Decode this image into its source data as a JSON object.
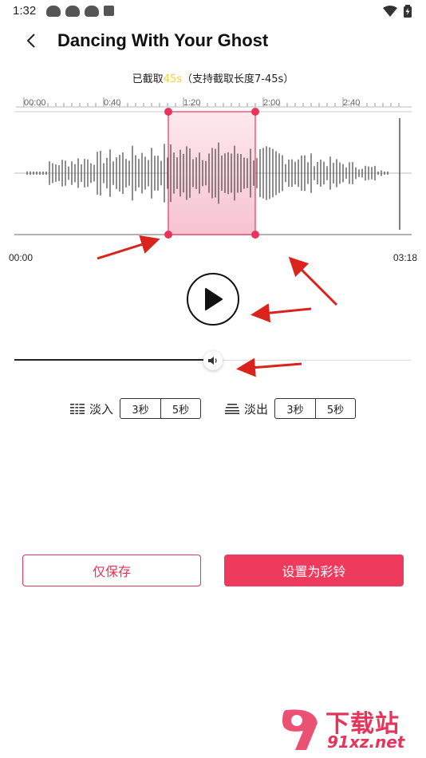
{
  "status_bar": {
    "time": "1:32"
  },
  "header": {
    "title": "Dancing With Your Ghost"
  },
  "clip_info": {
    "prefix": "已截取",
    "duration": "45s",
    "suffix": "（支持截取长度7-45s）"
  },
  "timeline": {
    "ticks": [
      "00:00",
      "0:40",
      "1:20",
      "2:00",
      "2:40"
    ],
    "start_label": "00:00",
    "end_label": "03:18"
  },
  "volume": {
    "level": 0.5
  },
  "fade_in": {
    "label": "淡入",
    "options": [
      "3秒",
      "5秒"
    ]
  },
  "fade_out": {
    "label": "淡出",
    "options": [
      "3秒",
      "5秒"
    ]
  },
  "actions": {
    "save_only": "仅保存",
    "set_ringtone": "设置为彩铃"
  },
  "colors": {
    "accent": "#ee3a5d",
    "highlight": "#f5d23c",
    "selection_fill": "#fbd5de"
  },
  "watermark": {
    "top": "下载站",
    "bottom": "91xz.net"
  }
}
